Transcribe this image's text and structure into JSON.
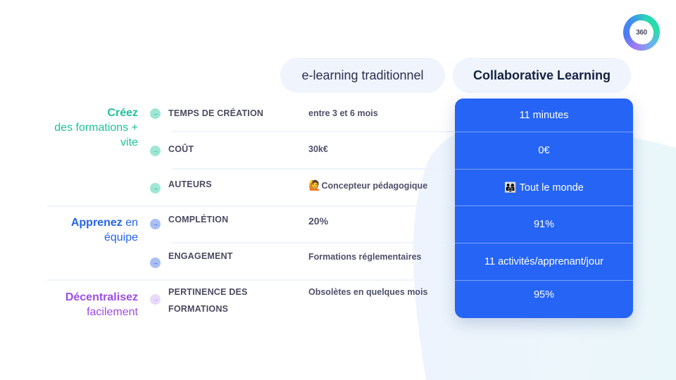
{
  "logo": {
    "text": "360"
  },
  "columns": {
    "traditional": "e-learning traditionnel",
    "collaborative": "Collaborative Learning"
  },
  "categories": [
    {
      "bold": "Créez",
      "rest": "des formations + vite",
      "color": "#1fc19c"
    },
    {
      "bold": "Apprenez",
      "rest": " en équipe",
      "color": "#2463eb"
    },
    {
      "bold": "Décentralisez",
      "rest": "facilement",
      "color": "#9d4ce8"
    }
  ],
  "rows": [
    {
      "label": "TEMPS DE CRÉATION",
      "traditional": "entre 3 et 6 mois",
      "collaborative": "11 minutes",
      "category": 0
    },
    {
      "label": "COÛT",
      "traditional": "30k€",
      "collaborative": "0€",
      "category": 0
    },
    {
      "label": "AUTEURS",
      "traditional_emoji": "🙋",
      "traditional": "Concepteur pédagogique",
      "collaborative_emoji": "👨‍👩‍👧",
      "collaborative": "Tout le monde",
      "category": 0
    },
    {
      "label": "COMPLÉTION",
      "traditional": "20%",
      "collaborative": "91%",
      "category": 1
    },
    {
      "label": "ENGAGEMENT",
      "traditional": "Formations réglementaires",
      "collaborative": "11 activités/apprenant/jour",
      "category": 1
    },
    {
      "label": "PERTINENCE DES FORMATIONS",
      "label_line1": "PERTINENCE DES",
      "label_line2": "FORMATIONS",
      "traditional": "Obsolètes en quelques mois",
      "collaborative": "95%",
      "category": 2
    }
  ],
  "icons": {
    "row_arrow": "→"
  },
  "colors": {
    "accent_blue": "#2564f4",
    "header_pill": "#eff4fd",
    "green": "#1fc19c",
    "blue": "#2463eb",
    "purple": "#9d4ce8"
  }
}
